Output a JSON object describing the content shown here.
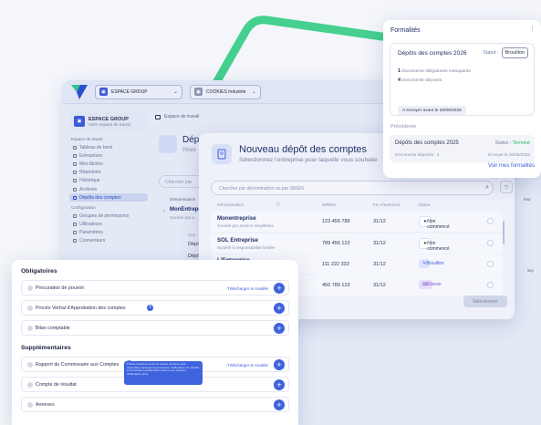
{
  "topbar": {
    "workspace_select": "ESPACE GROUP",
    "company_select": "COOKIES Industrie"
  },
  "sidebar": {
    "workspace_name": "ESPACE GROUP",
    "workspace_sub": "Votre espace de travail",
    "section_workspace": "Espace de travail",
    "items": [
      {
        "label": "Tableau de bord"
      },
      {
        "label": "Entreprises"
      },
      {
        "label": "Mes tâches"
      },
      {
        "label": "Répertoire"
      },
      {
        "label": "Historique"
      },
      {
        "label": "Archives"
      },
      {
        "label": "Dépôts des comptes"
      }
    ],
    "section_config": "Configuration",
    "config_items": [
      {
        "label": "Groupes de permissions"
      },
      {
        "label": "Utilisateurs"
      },
      {
        "label": "Paramètres"
      },
      {
        "label": "Connecteurs"
      }
    ]
  },
  "main": {
    "breadcrumb": "Espace de travail",
    "title_fragment": "Dép",
    "subtitle_fragment": "Pilote",
    "search_fragment": "Chercher par",
    "col_fragment": "Dénomination",
    "row_name_fragment": "MonEntrepr",
    "row_sub_fragment": "Société par a",
    "ann_fragment": "Ann",
    "dep_fragment_1": "Dépô",
    "dep_fragment_2": "Dépô",
    "right_fragment_1": "teur",
    "right_fragment_2": "ssy"
  },
  "modal": {
    "title": "Nouveau dépôt des comptes",
    "subtitle": "Sélectionnez l'entreprise pour laquelle vous souhaite",
    "search_placeholder": "Chercher par dénomination ou par SIREN",
    "columns": [
      "Dénomination",
      "SIREN",
      "Fin d'exercice",
      "Statut"
    ],
    "rows": [
      {
        "name": "Monentreprise",
        "type": "Société par actions simplifiées",
        "siren": "123 456 789",
        "fin": "31/12",
        "status": "Non commencé"
      },
      {
        "name": "SOL Entreprise",
        "type": "Société à responsabilité limitée",
        "siren": "789 456 123",
        "fin": "31/12",
        "status": "Non commencé"
      },
      {
        "name": "L'Entreprise",
        "type": "",
        "siren": "111 222 333",
        "fin": "31/12",
        "status": "Brouillon"
      },
      {
        "name": "",
        "type": "",
        "siren": "456 789 123",
        "fin": "31/12",
        "status": "Saisie"
      }
    ],
    "select_button": "Sélectionner"
  },
  "formalites": {
    "title": "Formalités",
    "current_name": "Dépôts des comptes 2026",
    "current_status_label": "Statut :",
    "current_status": "Brouillon",
    "missing_count": "1",
    "missing_label": "Documents obligatoires manquants",
    "deposited_count": "4",
    "deposited_label": "Documents déposés",
    "send_before": "A envoyer avant le 30/06/2025",
    "previous_label": "Précédente",
    "prev_name": "Dépôts des comptes 2025",
    "prev_status_label": "Statut :",
    "prev_status": "Terminé",
    "prev_docs": "Documents déposés : 4",
    "prev_sent": "Envoyer le 30/06/2025",
    "link": "Voir mes formalités"
  },
  "obligatoires": {
    "title": "Obligatoires",
    "items": [
      {
        "label": "Procuration de pouvoir",
        "link": "Télécharger le modèle"
      },
      {
        "label": "Procès Verbal d'Approbation des comptes",
        "link": ""
      },
      {
        "label": "Bilan comptable",
        "link": ""
      }
    ],
    "supp_title": "Supplémentaires",
    "supp_items": [
      {
        "label": "Rapport du Commissaire aux Comptes",
        "link": "Télécharger le modèle"
      },
      {
        "label": "Compte de résultat",
        "link": ""
      },
      {
        "label": "Annexes",
        "link": ""
      }
    ],
    "tooltip": "Procès Verbal au cours du procès ordinaire dans assemblée contenant la proposition d'affectation du résultat et la résolution d'affectation votée à une décision d'affectation prise"
  },
  "colors": {
    "accent": "#3e63dd",
    "ribbon": "#3fcf8e",
    "success": "#2fb36b",
    "draft": "#3c5bd6"
  }
}
